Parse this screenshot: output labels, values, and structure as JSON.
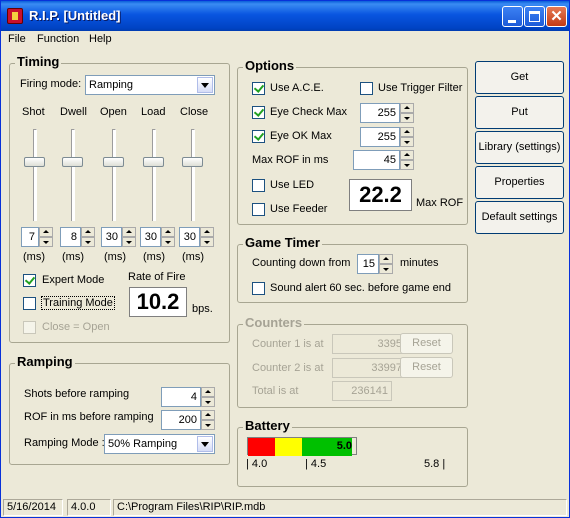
{
  "window": {
    "title": "R.I.P. [Untitled]"
  },
  "menu": [
    "File",
    "Function",
    "Help"
  ],
  "timing": {
    "title": "Timing",
    "firing_mode_label": "Firing mode:",
    "firing_mode_value": "Ramping",
    "columns": [
      "Shot",
      "Dwell",
      "Open",
      "Load",
      "Close"
    ],
    "values": [
      "7",
      "8",
      "30",
      "30",
      "30"
    ],
    "unit": "(ms)",
    "expert_mode": "Expert Mode",
    "training_mode": "Training Mode",
    "close_open": "Close = Open",
    "rate_of_fire_label": "Rate of Fire",
    "rate_of_fire_value": "10.2",
    "rate_unit": "bps."
  },
  "ramping": {
    "title": "Ramping",
    "shots_label": "Shots before ramping",
    "shots_value": "4",
    "rof_label": "ROF in ms before ramping",
    "rof_value": "200",
    "mode_label": "Ramping Mode :",
    "mode_value": "50% Ramping"
  },
  "options": {
    "title": "Options",
    "use_ace": "Use A.C.E.",
    "use_trigger_filter": "Use Trigger Filter",
    "eye_check_max": "Eye Check Max",
    "eye_check_max_value": "255",
    "eye_ok_max": "Eye OK Max",
    "eye_ok_max_value": "255",
    "max_rof_label": "Max ROF in ms",
    "max_rof_value": "45",
    "use_led": "Use LED",
    "use_feeder": "Use Feeder",
    "max_rof_display": "22.2",
    "max_rof_caption": "Max ROF"
  },
  "game_timer": {
    "title": "Game Timer",
    "counting_label": "Counting down from",
    "minutes_value": "15",
    "minutes_label": "minutes",
    "sound_alert": "Sound alert 60 sec. before game end"
  },
  "counters": {
    "title": "Counters",
    "counter1_label": "Counter 1 is at",
    "counter1_value": "3395",
    "counter2_label": "Counter 2 is at",
    "counter2_value": "33997",
    "total_label": "Total is at",
    "total_value": "236141",
    "reset_label": "Reset"
  },
  "battery": {
    "title": "Battery",
    "value": "5.0",
    "level": 5.0,
    "min_label": "| 4.0",
    "mid_label": "| 4.5",
    "max_label": "5.8 |",
    "colors": {
      "low": "#ff0000",
      "mid": "#ffff00",
      "high": "#00c000"
    }
  },
  "side_buttons": [
    "Get",
    "Put",
    "Library (settings)",
    "Properties",
    "Default settings"
  ],
  "status": {
    "date": "5/16/2014",
    "version": "4.0.0",
    "path": "C:\\Program Files\\RIP\\RIP.mdb"
  },
  "colors": {
    "title_bar": "#0a5fd8",
    "window_bg": "#ece9d8",
    "accent_border": "#0831d9"
  }
}
